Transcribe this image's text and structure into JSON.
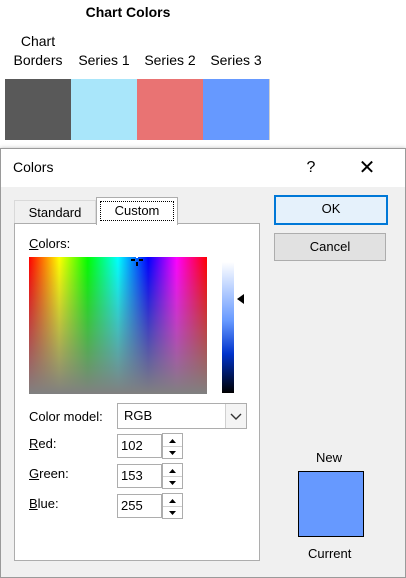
{
  "sheet": {
    "title": "Chart Colors",
    "columns": [
      {
        "header": "Chart\nBorders",
        "color": "#595959"
      },
      {
        "header": "Series 1",
        "color": "#a9e6fa"
      },
      {
        "header": "Series 2",
        "color": "#e97373"
      },
      {
        "header": "Series 3",
        "color": "#6699ff"
      }
    ]
  },
  "dialog": {
    "title": "Colors",
    "help_label": "?",
    "close_label": "✕",
    "tabs": [
      {
        "label": "Standard",
        "selected": false
      },
      {
        "label": "Custom",
        "selected": true
      }
    ],
    "colors_label_accel": "C",
    "colors_label_rest": "olors:",
    "color_model_label": "Color model:",
    "color_model_value": "RGB",
    "fields": [
      {
        "accel": "R",
        "rest": "ed:",
        "value": "102"
      },
      {
        "accel": "G",
        "rest": "reen:",
        "value": "153"
      },
      {
        "accel": "B",
        "rest": "lue:",
        "value": "255"
      }
    ],
    "ok_label": "OK",
    "cancel_label": "Cancel",
    "new_label": "New",
    "current_label": "Current",
    "new_color": "#6699ff",
    "current_color": "#6699ff"
  }
}
